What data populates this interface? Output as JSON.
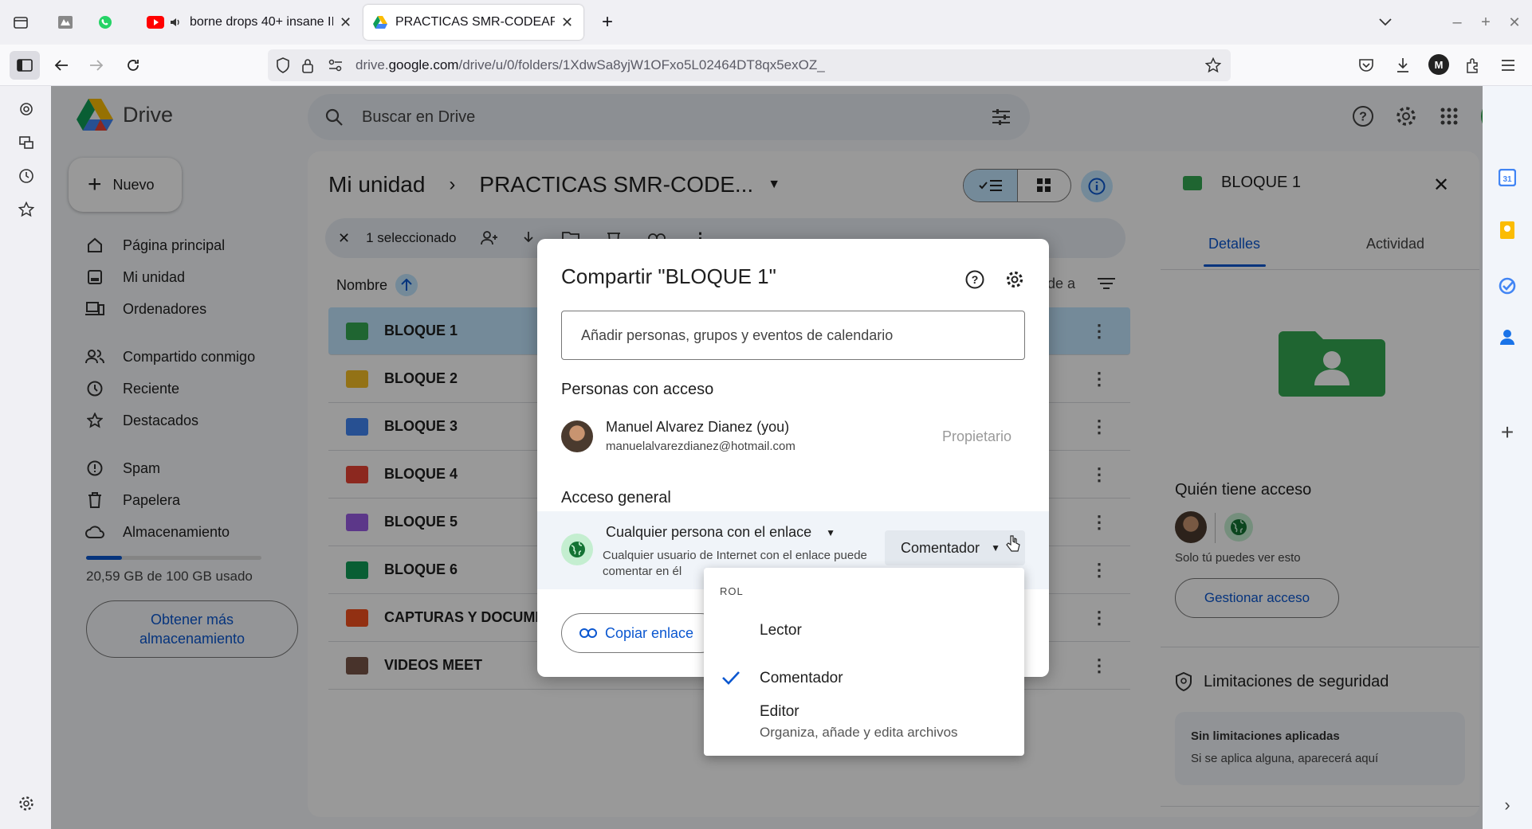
{
  "browser": {
    "tabs": [
      {
        "label": "borne drops 40+ insane II"
      },
      {
        "label": "PRACTICAS SMR-CODEARTS - G"
      }
    ],
    "url_prefix": "drive.",
    "url_domain": "google.com",
    "url_path": "/drive/u/0/folders/1XdwSa8yjW1OFxo5L02464DT8qx5exOZ_",
    "account_initial": "M"
  },
  "drive": {
    "logo_text": "Drive",
    "search_placeholder": "Buscar en Drive",
    "new_button": "Nuevo",
    "nav": [
      {
        "label": "Página principal"
      },
      {
        "label": "Mi unidad"
      },
      {
        "label": "Ordenadores"
      },
      {
        "label": "Compartido conmigo"
      },
      {
        "label": "Reciente"
      },
      {
        "label": "Destacados"
      },
      {
        "label": "Spam"
      },
      {
        "label": "Papelera"
      },
      {
        "label": "Almacenamiento"
      }
    ],
    "storage_text": "20,59 GB de 100 GB usado",
    "storage_used_fraction": 0.206,
    "get_more_storage": "Obtener más almacenamiento",
    "breadcrumb_root": "Mi unidad",
    "breadcrumb_current": "PRACTICAS SMR-CODE...",
    "selection_text": "1 seleccionado",
    "column_name": "Nombre",
    "column_partial": "de a",
    "files": [
      {
        "name": "BLOQUE 1",
        "color": "#34a853",
        "selected": true
      },
      {
        "name": "BLOQUE 2",
        "color": "#f6bf26"
      },
      {
        "name": "BLOQUE 3",
        "color": "#4285f4"
      },
      {
        "name": "BLOQUE 4",
        "color": "#ea4335"
      },
      {
        "name": "BLOQUE 5",
        "color": "#9a5de4"
      },
      {
        "name": "BLOQUE 6",
        "color": "#0f9d58"
      },
      {
        "name": "CAPTURAS Y DOCUMEI",
        "color": "#f4511e"
      },
      {
        "name": "VIDEOS MEET",
        "color": "#795548"
      }
    ]
  },
  "details": {
    "title": "BLOQUE 1",
    "tab_details": "Detalles",
    "tab_activity": "Actividad",
    "who_has_access": "Quién tiene acceso",
    "only_you": "Solo tú puedes ver esto",
    "manage_access": "Gestionar acceso",
    "security_title": "Limitaciones de seguridad",
    "security_none": "Sin limitaciones aplicadas",
    "security_hint": "Si se aplica alguna, aparecerá aquí"
  },
  "share_dialog": {
    "title": "Compartir \"BLOQUE 1\"",
    "add_placeholder": "Añadir personas, grupos y eventos de calendario",
    "people_heading": "Personas con acceso",
    "owner_name": "Manuel Alvarez Dianez (you)",
    "owner_email": "manuelalvarezdianez@hotmail.com",
    "owner_role": "Propietario",
    "general_heading": "Acceso general",
    "link_scope": "Cualquier persona con el enlace",
    "link_desc_1": "Cualquier usuario de Internet con el enlace puede",
    "link_desc_2": "comentar en él",
    "role_selected": "Comentador",
    "copy_link": "Copiar enlace"
  },
  "role_menu": {
    "heading": "ROL",
    "options": [
      {
        "label": "Lector",
        "desc": ""
      },
      {
        "label": "Comentador",
        "desc": "",
        "checked": true
      },
      {
        "label": "Editor",
        "desc": "Organiza, añade y edita archivos"
      }
    ]
  },
  "colors": {
    "accent": "#0b57d0",
    "folder_green": "#34a853",
    "selected_row": "#c2e7ff"
  }
}
